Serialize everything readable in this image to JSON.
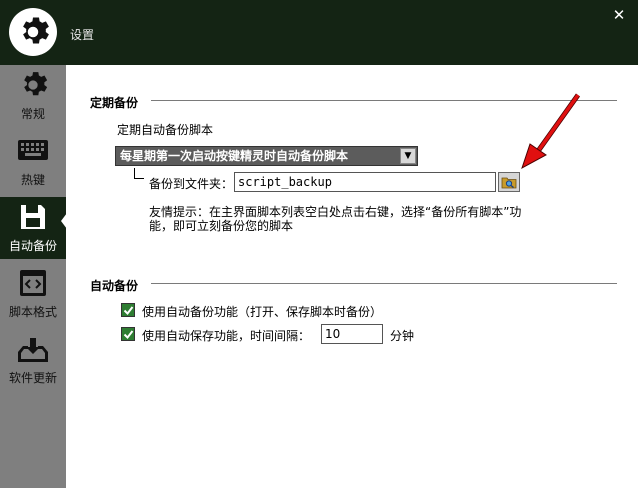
{
  "window": {
    "title": "设置",
    "close_glyph": "✕"
  },
  "sidebar": {
    "items": [
      {
        "label": "常规",
        "icon": "gear-icon"
      },
      {
        "label": "热键",
        "icon": "keyboard-icon"
      },
      {
        "label": "自动备份",
        "icon": "save-icon"
      },
      {
        "label": "脚本格式",
        "icon": "code-icon"
      },
      {
        "label": "软件更新",
        "icon": "download-tray-icon"
      }
    ],
    "active_index": 2
  },
  "backup_schedule": {
    "section_title": "定期备份",
    "description": "定期自动备份脚本",
    "schedule_value": "每星期第一次启动按键精灵时自动备份脚本",
    "folder_label": "备份到文件夹：",
    "folder_value": "script_backup",
    "hint_line1": "友情提示：在主界面脚本列表空白处点击右键，选择“备份所有脚本”功",
    "hint_line2": "能，即可立刻备份您的脚本"
  },
  "auto_backup": {
    "section_title": "自动备份",
    "option1_label": "使用自动备份功能（打开、保存脚本时备份）",
    "option1_checked": true,
    "option2_label": "使用自动保存功能，时间间隔：",
    "option2_checked": true,
    "interval_value": "10",
    "interval_unit": "分钟"
  },
  "colors": {
    "title_bar": "#142414",
    "sidebar": "#7f7f7f",
    "active_nav": "#142414",
    "checkbox": "#2e7d32",
    "annotation_arrow": "#e01010"
  }
}
